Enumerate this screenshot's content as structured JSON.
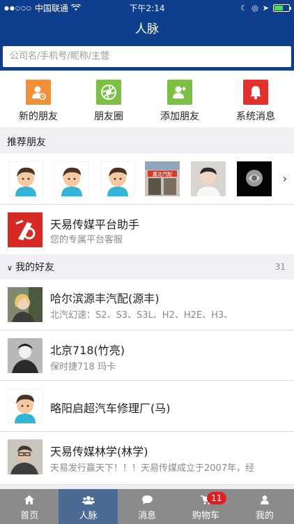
{
  "status_bar": {
    "carrier": "中国联通",
    "time": "下午2:14",
    "battery_level": 0.6
  },
  "header": {
    "title": "人脉"
  },
  "search": {
    "placeholder": "公司名/手机号/昵称/主营"
  },
  "quick_actions": [
    {
      "label": "新的朋友",
      "icon": "new-friend-icon",
      "color": "#f0913a"
    },
    {
      "label": "朋友圈",
      "icon": "moments-icon",
      "color": "#7cc043"
    },
    {
      "label": "添加朋友",
      "icon": "add-friend-icon",
      "color": "#7cc043"
    },
    {
      "label": "系统消息",
      "icon": "bell-icon",
      "color": "#e0312c"
    }
  ],
  "recommended": {
    "title": "推荐朋友",
    "sign_text": "鑫北汽配"
  },
  "assistant": {
    "name": "天易传媒平台助手",
    "subtitle": "您的专属平台客服"
  },
  "friends": {
    "title": "我的好友",
    "count": "31",
    "items": [
      {
        "name": "哈尔滨源丰汽配(源丰)",
        "subtitle": "北汽幻速：S2、S3、S3L、H2、H2E、H3、"
      },
      {
        "name": "北京718(竹亮)",
        "subtitle": "保时捷718 玛卡"
      },
      {
        "name": "略阳启超汽车修理厂(马)",
        "subtitle": ""
      },
      {
        "name": "天易传媒林学(林学)",
        "subtitle": "天易发行赢天下！！！天易传媒成立于2007年，经"
      }
    ]
  },
  "tabbar": {
    "items": [
      {
        "label": "首页",
        "icon": "home-icon"
      },
      {
        "label": "人脉",
        "icon": "contacts-icon"
      },
      {
        "label": "消息",
        "icon": "chat-icon"
      },
      {
        "label": "购物车",
        "icon": "cart-icon"
      },
      {
        "label": "我的",
        "icon": "user-icon"
      }
    ],
    "cart_badge": "11"
  },
  "colors": {
    "primary": "#0f3f8c",
    "tab_active": "#4b6b92",
    "badge": "#e02020"
  }
}
